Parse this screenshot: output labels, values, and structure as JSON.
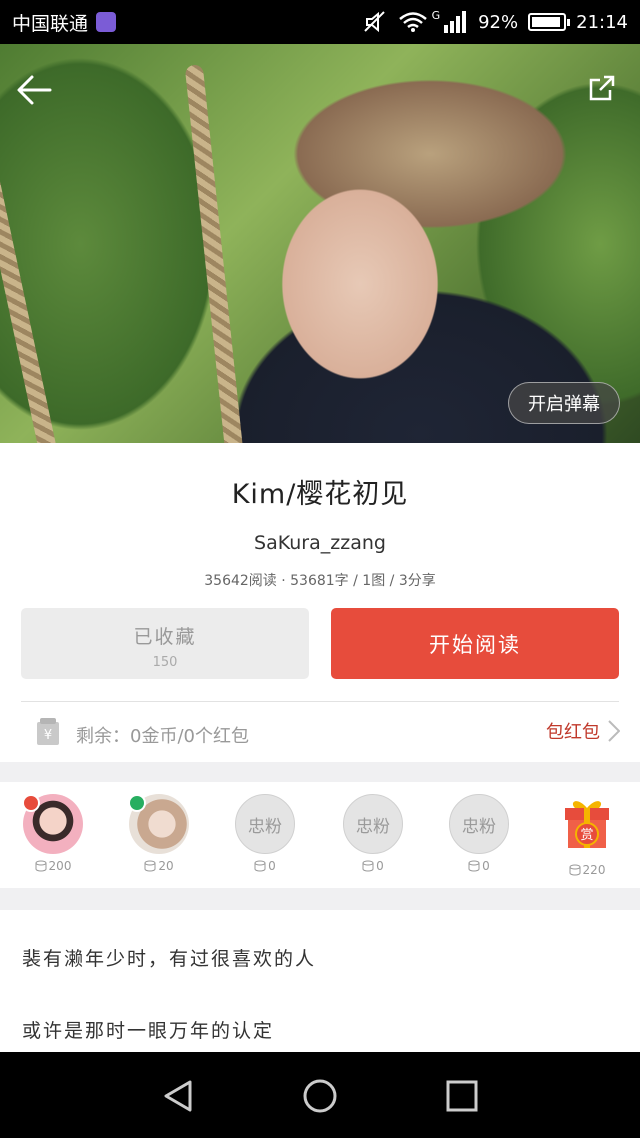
{
  "status_bar": {
    "carrier": "中国联通",
    "g_label": "G",
    "battery_percent": "92%",
    "time": "21:14",
    "battery_level": 0.92
  },
  "cover": {
    "danmaku_label": "开启弹幕"
  },
  "book": {
    "title": "Kim/樱花初见",
    "author": "SaKura_zzang",
    "stats": "35642阅读 · 53681字 / 1图 / 3分享"
  },
  "actions": {
    "collect_label": "已收藏",
    "collect_count": "150",
    "read_label": "开始阅读"
  },
  "redpack": {
    "remain_text": "剩余：0金币/0个红包",
    "give_label": "包红包"
  },
  "fans": [
    {
      "type": "avatar",
      "amount": "200",
      "badge_color": "#e74c3c"
    },
    {
      "type": "avatar",
      "amount": "20",
      "badge_color": "#27ae60"
    },
    {
      "type": "loyal",
      "label": "忠粉",
      "amount": "0"
    },
    {
      "type": "loyal",
      "label": "忠粉",
      "amount": "0"
    },
    {
      "type": "loyal",
      "label": "忠粉",
      "amount": "0"
    },
    {
      "type": "reward",
      "label": "赏",
      "amount": "220"
    }
  ],
  "story": {
    "line1": "裴有濑年少时，有过很喜欢的人",
    "line2": "或许是那时一眼万年的认定"
  },
  "colors": {
    "accent": "#e74c3c",
    "redpack_text": "#c0392b"
  },
  "icons": [
    "back-arrow-icon",
    "share-icon",
    "coin-icon",
    "chevron-right-icon",
    "triangle-back-icon",
    "circle-home-icon",
    "square-recent-icon"
  ]
}
